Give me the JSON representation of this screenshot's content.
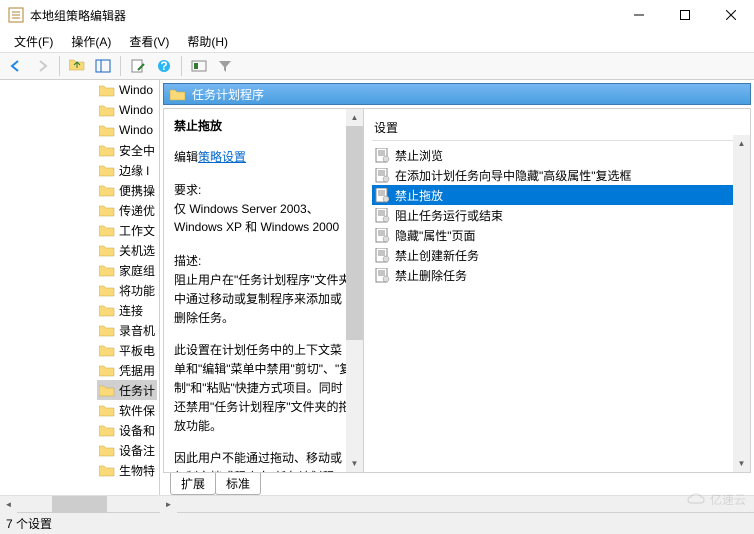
{
  "window": {
    "title": "本地组策略编辑器"
  },
  "menu": {
    "file": "文件(F)",
    "action": "操作(A)",
    "view": "查看(V)",
    "help": "帮助(H)"
  },
  "tree": {
    "items": [
      {
        "label": "Windo"
      },
      {
        "label": "Windo"
      },
      {
        "label": "Windo"
      },
      {
        "label": "安全中"
      },
      {
        "label": "边缘 l"
      },
      {
        "label": "便携操"
      },
      {
        "label": "传递优"
      },
      {
        "label": "工作文"
      },
      {
        "label": "关机选"
      },
      {
        "label": "家庭组"
      },
      {
        "label": "将功能"
      },
      {
        "label": "连接"
      },
      {
        "label": "录音机"
      },
      {
        "label": "平板电"
      },
      {
        "label": "凭据用"
      },
      {
        "label": "任务计",
        "sel": true
      },
      {
        "label": "软件保"
      },
      {
        "label": "设备和"
      },
      {
        "label": "设备注"
      },
      {
        "label": "生物特"
      }
    ]
  },
  "header": {
    "title": "任务计划程序"
  },
  "desc": {
    "title": "禁止拖放",
    "edit_prefix": "编辑",
    "edit_link": "策略设置",
    "req_label": "要求:",
    "req_text": "仅 Windows Server 2003、Windows XP 和 Windows 2000",
    "desc_label": "描述:",
    "p1": "阻止用户在\"任务计划程序\"文件夹中通过移动或复制程序来添加或删除任务。",
    "p2": "此设置在计划任务中的上下文菜单和\"编辑\"菜单中禁用\"剪切\"、\"复制\"和\"粘贴\"快捷方式项目。同时还禁用\"任务计划程序\"文件夹的拖放功能。",
    "p3": "因此用户不能通过拖动、移动或复制文档或程序向\"任务计划程序\"文"
  },
  "settings": {
    "col": "设置",
    "items": [
      {
        "label": "禁止浏览"
      },
      {
        "label": "在添加计划任务向导中隐藏\"高级属性\"复选框"
      },
      {
        "label": "禁止拖放",
        "sel": true
      },
      {
        "label": "阻止任务运行或结束"
      },
      {
        "label": "隐藏\"属性\"页面"
      },
      {
        "label": "禁止创建新任务"
      },
      {
        "label": "禁止删除任务"
      }
    ]
  },
  "tabs": {
    "extended": "扩展",
    "standard": "标准"
  },
  "status": "7 个设置",
  "watermark": "亿速云"
}
